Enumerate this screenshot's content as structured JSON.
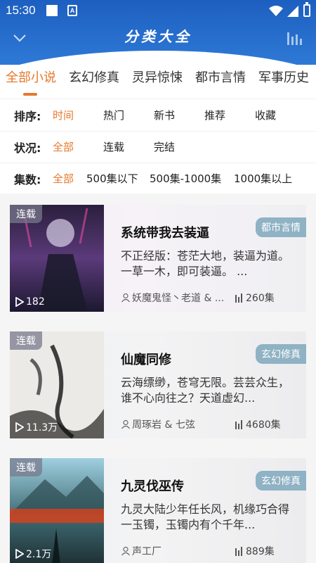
{
  "status_bar": {
    "time": "15:30"
  },
  "header": {
    "title": "分类大全"
  },
  "tabs": [
    {
      "label": "全部小说",
      "active": true
    },
    {
      "label": "玄幻修真"
    },
    {
      "label": "灵异惊悚"
    },
    {
      "label": "都市言情"
    },
    {
      "label": "军事历史"
    }
  ],
  "filters": {
    "sort": {
      "label": "排序:",
      "options": [
        "时间",
        "热门",
        "新书",
        "推荐",
        "收藏"
      ],
      "selected": "时间"
    },
    "status": {
      "label": "状况:",
      "options": [
        "全部",
        "连载",
        "完结"
      ],
      "selected": "全部"
    },
    "episodes": {
      "label": "集数:",
      "options": [
        "全部",
        "500集以下",
        "500集-1000集",
        "1000集以上"
      ],
      "selected": "全部"
    }
  },
  "colors": {
    "accent": "#e5792c",
    "header_blue": "#2e79d6",
    "tag_bg": "#8fb2c4"
  },
  "books": [
    {
      "badge": "连载",
      "views": "182",
      "title": "系统带我去装逼",
      "tag": "都市言情",
      "description": "不正经版：苍茫大地，装逼为道。一草一木，即可装逼。 ...",
      "author": "妖魔鬼怪丶老道 & ...",
      "episodes": "260集",
      "cover_text": "系统带我去装逼"
    },
    {
      "badge": "连载",
      "views": "11.3万",
      "title": "仙魔同修",
      "tag": "玄幻修真",
      "description": "云海缥缈，苍穹无限。芸芸众生，谁不心向往之？天道虚幻...",
      "author": "周琢岩 & 七弦",
      "episodes": "4680集",
      "cover_text": "仙魔同修"
    },
    {
      "badge": "连载",
      "views": "2.1万",
      "title": "九灵伐巫传",
      "tag": "玄幻修真",
      "description": "九灵大陆少年任长风，机缘巧合得一玉镯，玉镯内有个千年...",
      "author": "声工厂",
      "episodes": "889集",
      "cover_text": "九灵伐巫传"
    }
  ]
}
